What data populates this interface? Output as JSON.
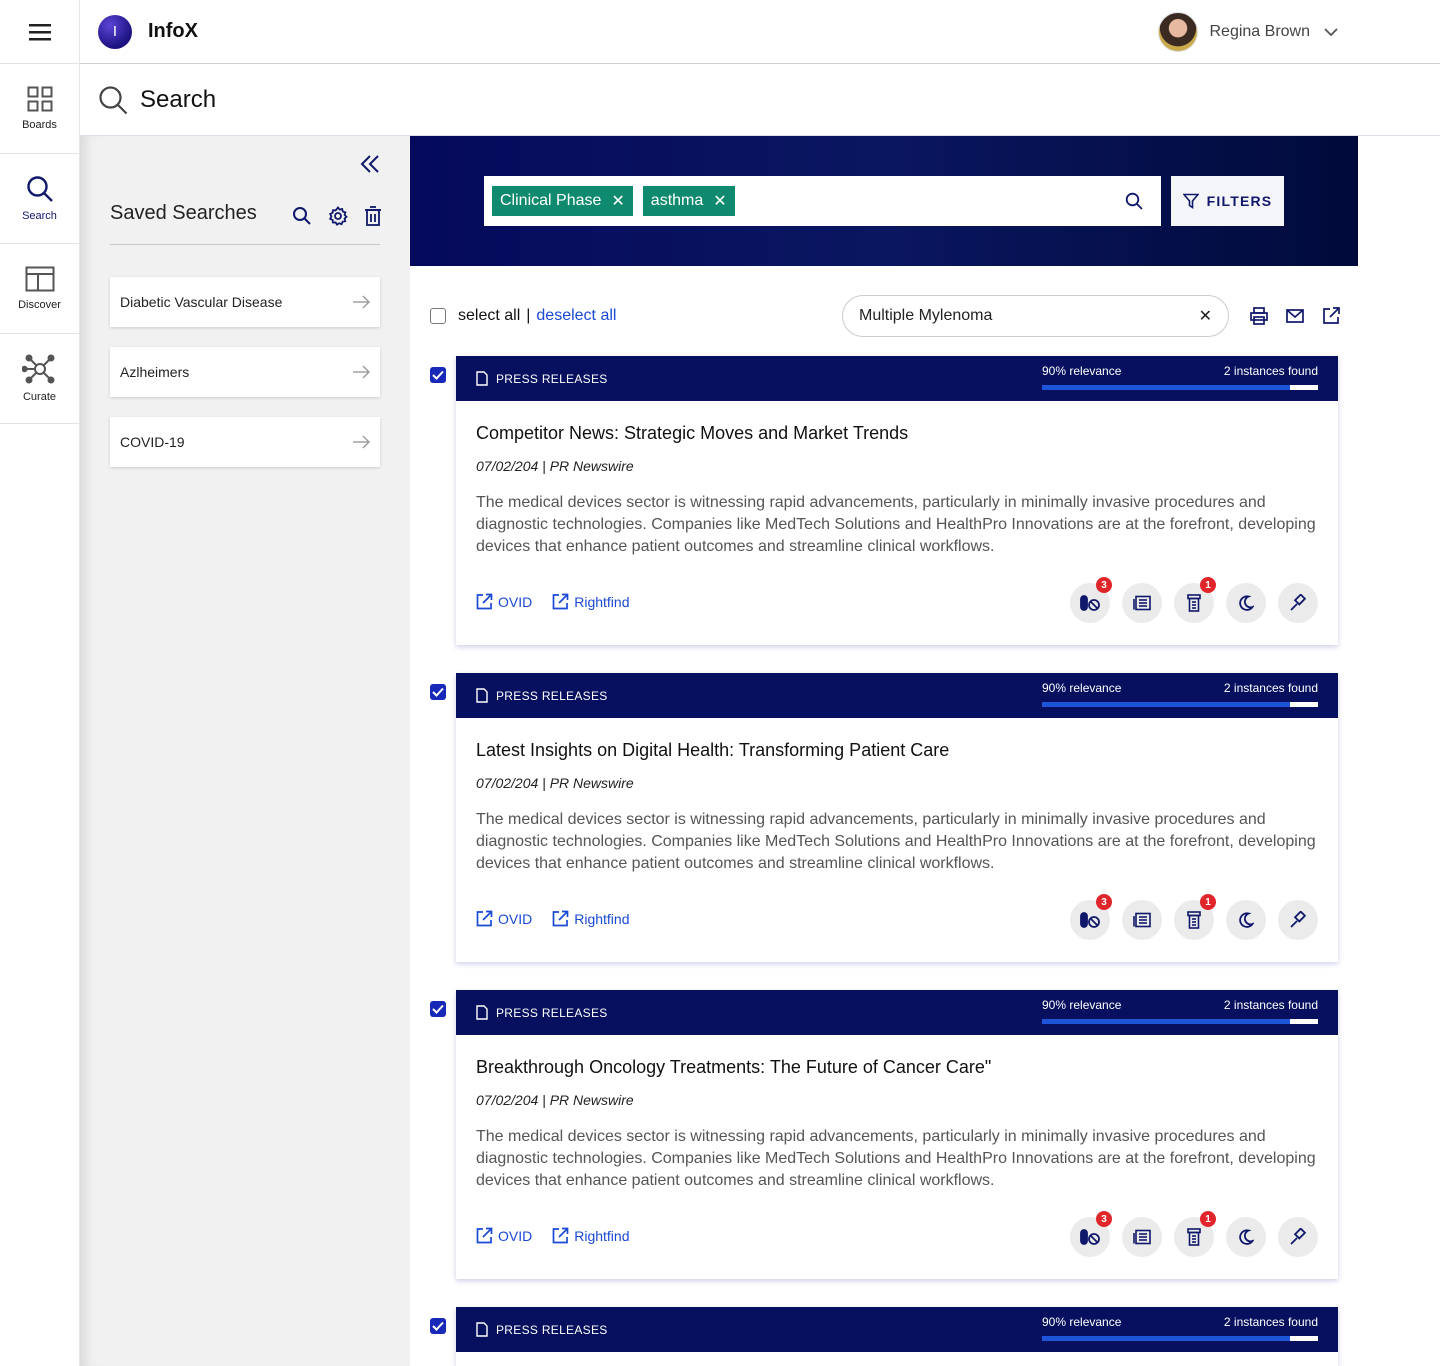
{
  "app": {
    "name": "InfoX",
    "logo_letter": "I"
  },
  "user": {
    "name": "Regina Brown"
  },
  "nav": [
    {
      "label": "Boards",
      "icon": "boards-icon"
    },
    {
      "label": "Search",
      "icon": "search-icon"
    },
    {
      "label": "Discover",
      "icon": "discover-icon"
    },
    {
      "label": "Curate",
      "icon": "curate-icon"
    }
  ],
  "page": {
    "title": "Search"
  },
  "saved_searches": {
    "title": "Saved Searches",
    "items": [
      {
        "label": "Diabetic Vascular Disease"
      },
      {
        "label": "Azlheimers"
      },
      {
        "label": "COVID-19"
      }
    ]
  },
  "search": {
    "chips": [
      {
        "label": "Clinical Phase"
      },
      {
        "label": "asthma"
      }
    ],
    "filters_label": "FILTERS"
  },
  "selection": {
    "select_all": "select all",
    "separator": "|",
    "deselect_all": "deselect all"
  },
  "filter_input": {
    "value": "Multiple Mylenoma"
  },
  "colors": {
    "header_navy": "#06105e",
    "chip_green": "#0f8a6e",
    "link_blue": "#1a49d6",
    "badge_red": "#e0262b"
  },
  "results": [
    {
      "category": "PRESS RELEASES",
      "relevance_label": "90% relevance",
      "relevance": 0.9,
      "instances": "2 instances found",
      "title": "Competitor News: Strategic Moves and Market Trends",
      "meta": "07/02/204 | PR Newswire",
      "description": "The medical devices sector is witnessing rapid advancements, particularly in minimally invasive procedures and diagnostic technologies. Companies like MedTech Solutions and HealthPro Innovations are at the forefront, developing devices that enhance patient outcomes and streamline clinical workflows.",
      "links": [
        "OVID",
        "Rightfind"
      ],
      "badges": {
        "pills": "3",
        "bottle": "1"
      }
    },
    {
      "category": "PRESS RELEASES",
      "relevance_label": "90% relevance",
      "relevance": 0.9,
      "instances": "2 instances found",
      "title": "Latest Insights on Digital Health: Transforming Patient Care",
      "meta": "07/02/204 | PR Newswire",
      "description": "The medical devices sector is witnessing rapid advancements, particularly in minimally invasive procedures and diagnostic technologies. Companies like MedTech Solutions and HealthPro Innovations are at the forefront, developing devices that enhance patient outcomes and streamline clinical workflows.",
      "links": [
        "OVID",
        "Rightfind"
      ],
      "badges": {
        "pills": "3",
        "bottle": "1"
      }
    },
    {
      "category": "PRESS RELEASES",
      "relevance_label": "90% relevance",
      "relevance": 0.9,
      "instances": "2 instances found",
      "title": "Breakthrough Oncology Treatments: The Future of Cancer Care\"",
      "meta": "07/02/204 | PR Newswire",
      "description": "The medical devices sector is witnessing rapid advancements, particularly in minimally invasive procedures and diagnostic technologies. Companies like MedTech Solutions and HealthPro Innovations are at the forefront, developing devices that enhance patient outcomes and streamline clinical workflows.",
      "links": [
        "OVID",
        "Rightfind"
      ],
      "badges": {
        "pills": "3",
        "bottle": "1"
      }
    },
    {
      "category": "PRESS RELEASES",
      "relevance_label": "90% relevance",
      "relevance": 0.9,
      "instances": "2 instances found"
    }
  ]
}
